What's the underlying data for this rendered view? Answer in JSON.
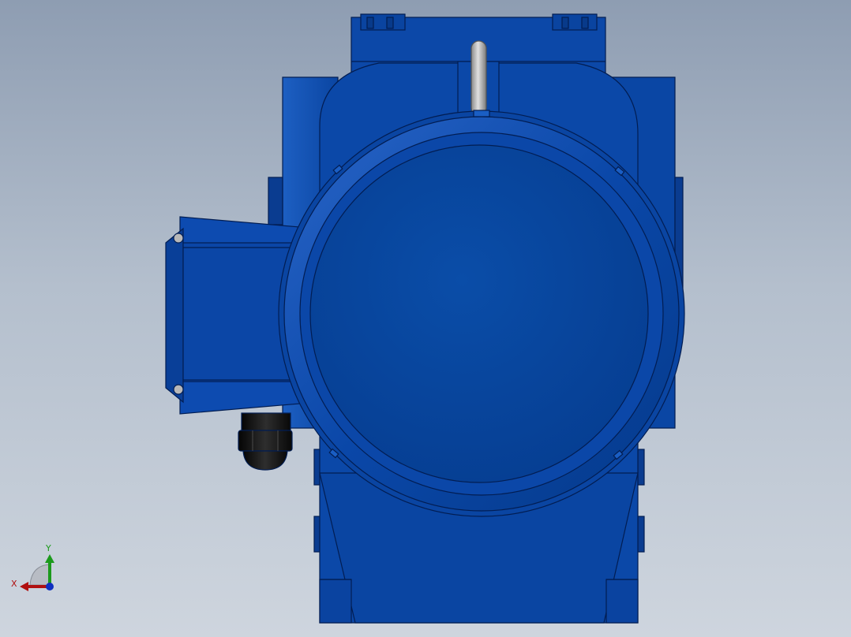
{
  "viewport": {
    "background_top": "#8e9db2",
    "background_bottom": "#ced5de"
  },
  "model": {
    "body_color": "#0b47a6",
    "body_dark": "#063a8c",
    "edge_color": "#021d52",
    "highlight_color": "#2a6ad0",
    "lifting_eye_color": "#a8a8a8",
    "cable_gland_color": "#1a1a1a"
  },
  "triad": {
    "x_label": "X",
    "y_label": "Y",
    "x_color": "#b01010",
    "y_color": "#1c9a1c",
    "z_color": "#1030c0"
  }
}
